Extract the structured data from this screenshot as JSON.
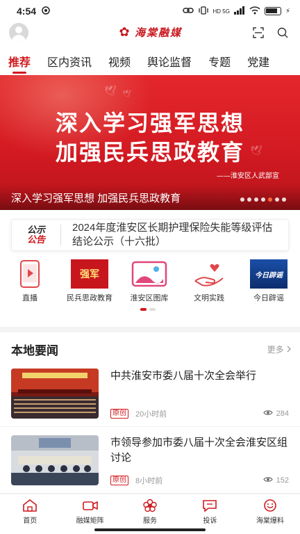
{
  "status_bar": {
    "time": "4:54",
    "network": "HD 5G"
  },
  "header": {
    "logo_text": "海棠融媒",
    "logo_icon": "crabapple-flower-icon"
  },
  "tabs": [
    {
      "label": "推荐",
      "active": true
    },
    {
      "label": "区内资讯",
      "active": false
    },
    {
      "label": "视频",
      "active": false
    },
    {
      "label": "舆论监督",
      "active": false
    },
    {
      "label": "专题",
      "active": false
    },
    {
      "label": "党建",
      "active": false
    }
  ],
  "banner": {
    "heading_line1": "深入学习强军思想",
    "heading_line2": "加强民兵思政教育",
    "signature": "——淮安区人武部宣",
    "caption": "深入学习强军思想 加强民兵思政教育",
    "slide_count": 7,
    "active_slide": 5
  },
  "notice": {
    "badge_top": "公示",
    "badge_bottom": "公告",
    "text": "2024年度淮安区长期护理保险失能等级评估结论公示（十六批）"
  },
  "quick_links": [
    {
      "label": "直播",
      "icon": "live-play-icon"
    },
    {
      "label": "民兵思政教育",
      "icon": "militia-education-icon",
      "icon_text": "强军"
    },
    {
      "label": "淮安区图库",
      "icon": "gallery-icon"
    },
    {
      "label": "文明实践",
      "icon": "helping-hand-icon"
    },
    {
      "label": "今日辟谣",
      "icon": "rumor-debunk-icon",
      "icon_text": "今日辟谣"
    }
  ],
  "local_news": {
    "title": "本地要闻",
    "more": "更多",
    "items": [
      {
        "title": "中共淮安市委八届十次全会举行",
        "badge": "原创",
        "time": "20小时前",
        "views": "284"
      },
      {
        "title": "市领导参加市委八届十次全会淮安区组讨论",
        "badge": "原创",
        "time": "8小时前",
        "views": "152"
      }
    ]
  },
  "bottom_nav": [
    {
      "label": "首页",
      "icon": "home-icon"
    },
    {
      "label": "融媒矩阵",
      "icon": "video-camera-icon"
    },
    {
      "label": "服务",
      "icon": "service-flower-icon"
    },
    {
      "label": "投诉",
      "icon": "complaint-chat-icon"
    },
    {
      "label": "海棠爆料",
      "icon": "tip-off-icon"
    }
  ],
  "colors": {
    "brand_red": "#d0191e",
    "banner_red": "#d41a22",
    "muted_text": "#999999"
  }
}
